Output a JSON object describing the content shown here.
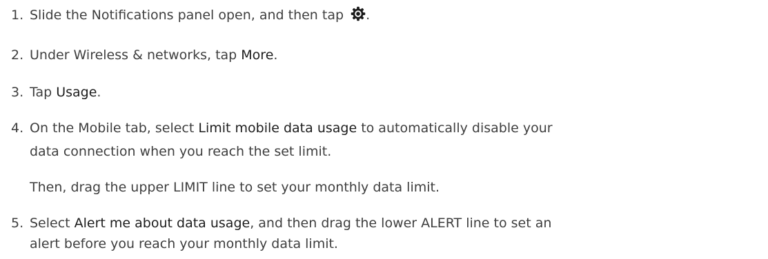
{
  "steps": [
    {
      "number": "1.",
      "before": "Slide the Notifications panel open, and then tap ",
      "icon": "settings-gear-icon",
      "after": "."
    },
    {
      "number": "2.",
      "before": "Under Wireless & networks, tap ",
      "strong": "More",
      "after": "."
    },
    {
      "number": "3.",
      "before": "Tap ",
      "strong": "Usage",
      "after": "."
    },
    {
      "number": "4.",
      "before": "On the Mobile tab, select ",
      "strong": "Limit mobile data usage",
      "after": " to automatically disable your",
      "line2": "data connection when you reach the set limit.",
      "note": "Then, drag the upper LIMIT line to set your monthly data limit."
    },
    {
      "number": "5.",
      "before": "Select ",
      "strong": "Alert me about data usage",
      "after": ", and then drag the lower ALERT line to set an",
      "line2": "alert before you reach your monthly data limit."
    }
  ]
}
